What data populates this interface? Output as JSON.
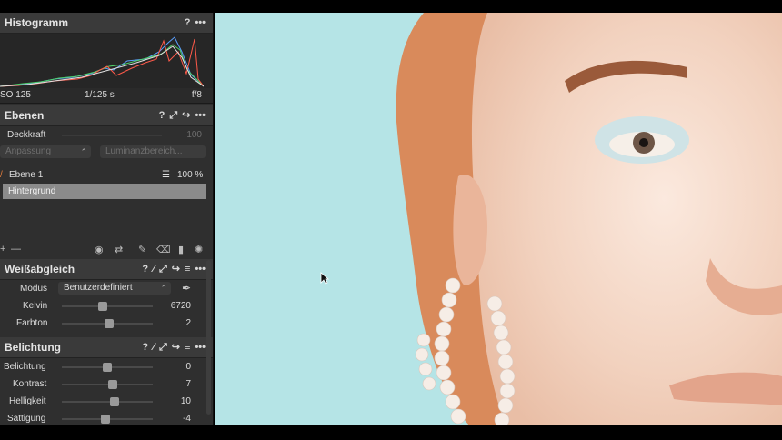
{
  "histogram": {
    "title": "Histogramm",
    "help": "?",
    "more": "•••",
    "iso": "SO 125",
    "shutter": "1/125 s",
    "aperture": "f/8"
  },
  "layers": {
    "title": "Ebenen",
    "help": "?",
    "more": "•••",
    "opacity_label": "Deckkraft",
    "opacity_value": "100",
    "adjust_label": "Anpassung",
    "luminance_label": "Luminanzbereich...",
    "layer1_name": "Ebene 1",
    "layer1_value": "100 %",
    "background_name": "Hintergrund"
  },
  "white_balance": {
    "title": "Weißabgleich",
    "help": "?",
    "more": "•••",
    "mode_label": "Modus",
    "mode_value": "Benutzerdefiniert",
    "kelvin_label": "Kelvin",
    "kelvin_value": "6720",
    "kelvin_level": 0.45,
    "tint_label": "Farbton",
    "tint_value": "2",
    "tint_level": 0.52
  },
  "exposure": {
    "title": "Belichtung",
    "help": "?",
    "more": "•••",
    "exposure_label": "Belichtung",
    "exposure_value": "0",
    "exposure_level": 0.5,
    "contrast_label": "Kontrast",
    "contrast_value": "7",
    "contrast_level": 0.56,
    "brightness_label": "Helligkeit",
    "brightness_value": "10",
    "brightness_level": 0.58,
    "saturation_label": "Sättigung",
    "saturation_value": "-4",
    "saturation_level": 0.48
  },
  "colors": {
    "panel_bg": "#2f2f2f",
    "header_bg": "#3a3a3a",
    "selected_layer": "#8b8b8b",
    "backdrop": "#b5e4e6",
    "accent": "#e07a3a"
  }
}
